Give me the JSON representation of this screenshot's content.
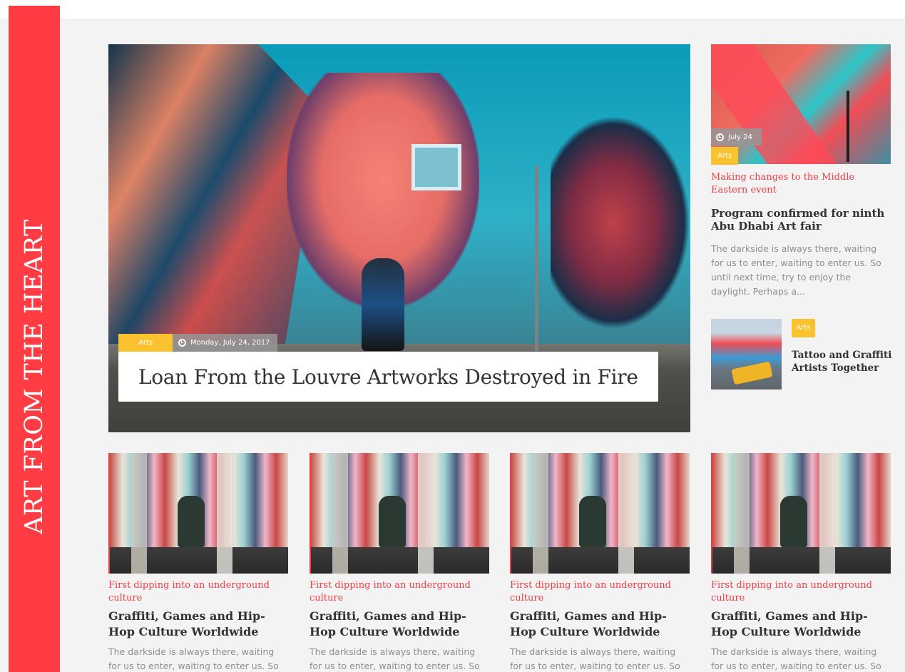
{
  "site": {
    "section_title": "ART FROM THE HEART"
  },
  "featured": {
    "category": "Arts",
    "date": "Monday, July 24, 2017",
    "title": "Loan From the Louvre Artworks Destroyed in Fire"
  },
  "side_story": {
    "date": "July 24",
    "category": "Arts",
    "kicker": "Making changes to the Middle Eastern event",
    "headline": "Program confirmed for ninth Abu Dhabi Art fair",
    "excerpt": "The darkside is always there, waiting for us to enter, waiting to enter us. So until next time, try to enjoy the daylight. Perhaps a..."
  },
  "mini_story": {
    "category": "Arts",
    "headline": "Tattoo and Graffiti Artists Together"
  },
  "cards": [
    {
      "kicker": "First dipping into an underground culture",
      "headline": "Graffiti, Games and Hip-Hop Culture Worldwide",
      "excerpt": "The darkside is always there, waiting for us to enter, waiting to enter us. So until"
    },
    {
      "kicker": "First dipping into an underground culture",
      "headline": "Graffiti, Games and Hip-Hop Culture Worldwide",
      "excerpt": "The darkside is always there, waiting for us to enter, waiting to enter us. So until"
    },
    {
      "kicker": "First dipping into an underground culture",
      "headline": "Graffiti, Games and Hip-Hop Culture Worldwide",
      "excerpt": "The darkside is always there, waiting for us to enter, waiting to enter us. So until"
    },
    {
      "kicker": "First dipping into an underground culture",
      "headline": "Graffiti, Games and Hip-Hop Culture Worldwide",
      "excerpt": "The darkside is always there, waiting for us to enter, waiting to enter us. So until"
    }
  ],
  "colors": {
    "accent_red": "#ee3d45",
    "tag_yellow": "#f9c22e",
    "panel_gray": "#f3f3f3"
  }
}
